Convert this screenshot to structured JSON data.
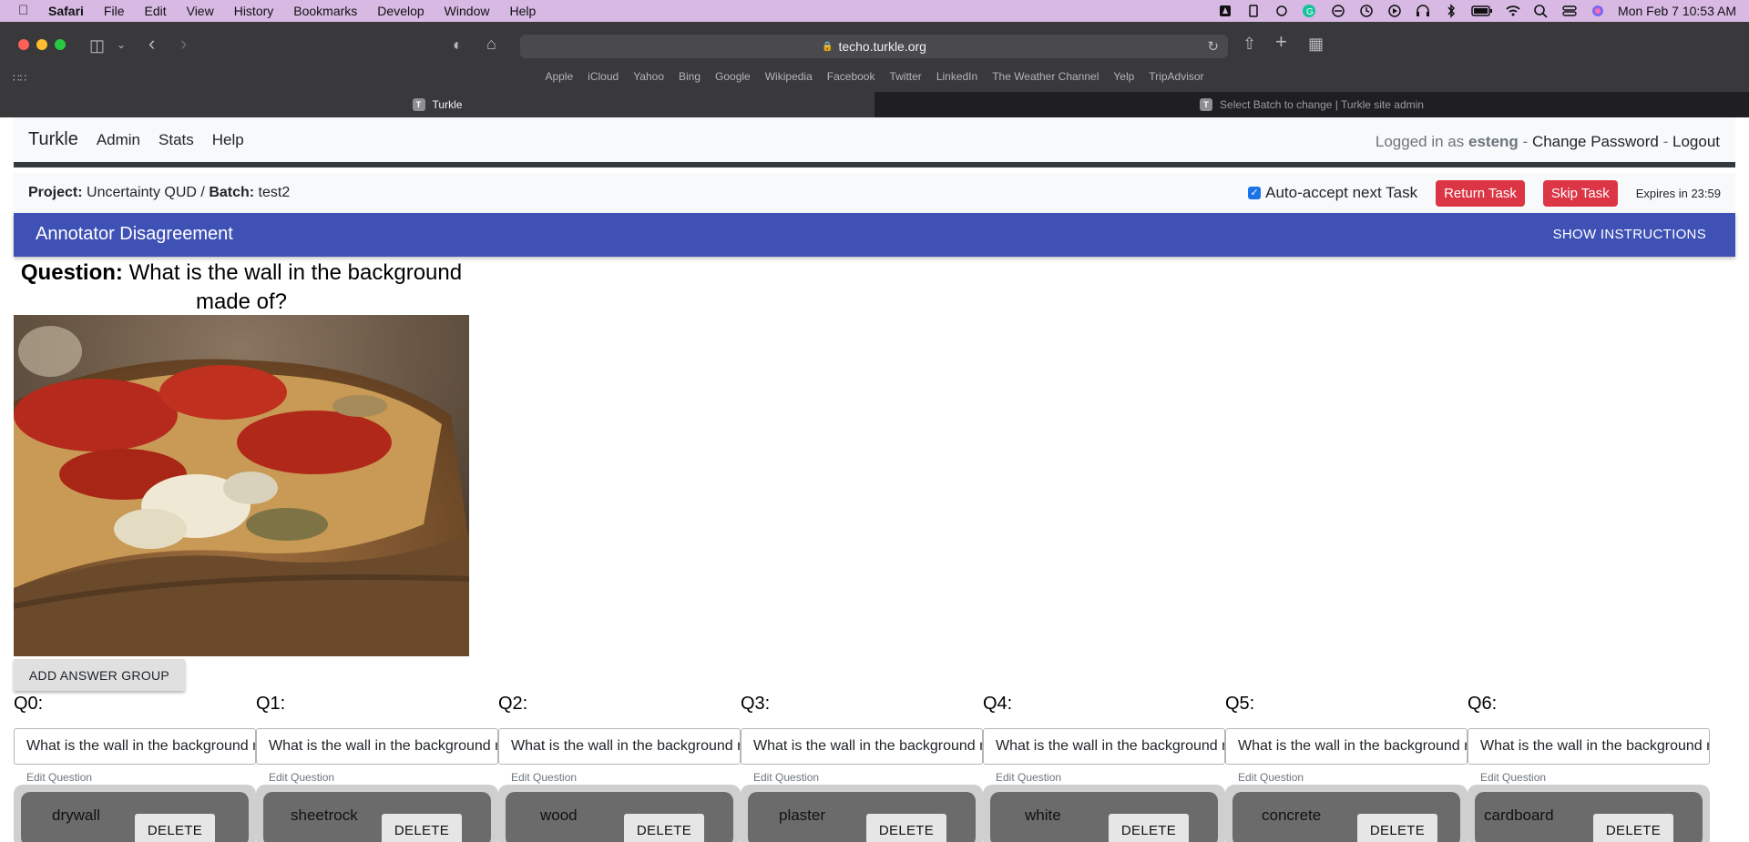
{
  "menubar": {
    "app": "Safari",
    "items": [
      "File",
      "Edit",
      "View",
      "History",
      "Bookmarks",
      "Develop",
      "Window",
      "Help"
    ],
    "clock": "Mon Feb 7  10:53 AM"
  },
  "browser": {
    "url": "techo.turkle.org",
    "favorites": [
      "Apple",
      "iCloud",
      "Yahoo",
      "Bing",
      "Google",
      "Wikipedia",
      "Facebook",
      "Twitter",
      "LinkedIn",
      "The Weather Channel",
      "Yelp",
      "TripAdvisor"
    ],
    "tabs": [
      {
        "label": "Turkle",
        "favicon": "T"
      },
      {
        "label": "Select Batch to change | Turkle site admin",
        "favicon": "T"
      }
    ]
  },
  "nav": {
    "brand": "Turkle",
    "links": [
      "Admin",
      "Stats",
      "Help"
    ],
    "logged_in_prefix": "Logged in as",
    "username": "esteng",
    "sep": "-",
    "change_password": "Change Password",
    "logout": "Logout"
  },
  "project": {
    "project_label": "Project:",
    "project_name": "Uncertainty QUD",
    "slash": "/",
    "batch_label": "Batch:",
    "batch_name": "test2",
    "auto_accept": "Auto-accept next Task",
    "return_task": "Return Task",
    "skip_task": "Skip Task",
    "expires": "Expires in 23:59"
  },
  "appbar": {
    "title": "Annotator Disagreement",
    "show_instructions": "SHOW INSTRUCTIONS"
  },
  "question": {
    "label": "Question:",
    "text": "What is the wall in the background made of?"
  },
  "add_group": "ADD ANSWER GROUP",
  "edit_question": "Edit Question",
  "delete_label": "DELETE",
  "qgroups": [
    {
      "label": "Q0:",
      "value": "What is the wall in the background made of?",
      "answer": "drywall"
    },
    {
      "label": "Q1:",
      "value": "What is the wall in the background made of?",
      "answer": "sheetrock"
    },
    {
      "label": "Q2:",
      "value": "What is the wall in the background made of?",
      "answer": "wood"
    },
    {
      "label": "Q3:",
      "value": "What is the wall in the background made of?",
      "answer": "plaster"
    },
    {
      "label": "Q4:",
      "value": "What is the wall in the background made of?",
      "answer": "white"
    },
    {
      "label": "Q5:",
      "value": "What is the wall in the background made of?",
      "answer": "concrete"
    },
    {
      "label": "Q6:",
      "value": "What is the wall in the background made of?",
      "answer": "cardboard"
    }
  ],
  "colors": {
    "appbar": "#3f51b5",
    "danger": "#dc3545",
    "menubar": "#d7b9e4",
    "toolbar": "#39383b"
  }
}
